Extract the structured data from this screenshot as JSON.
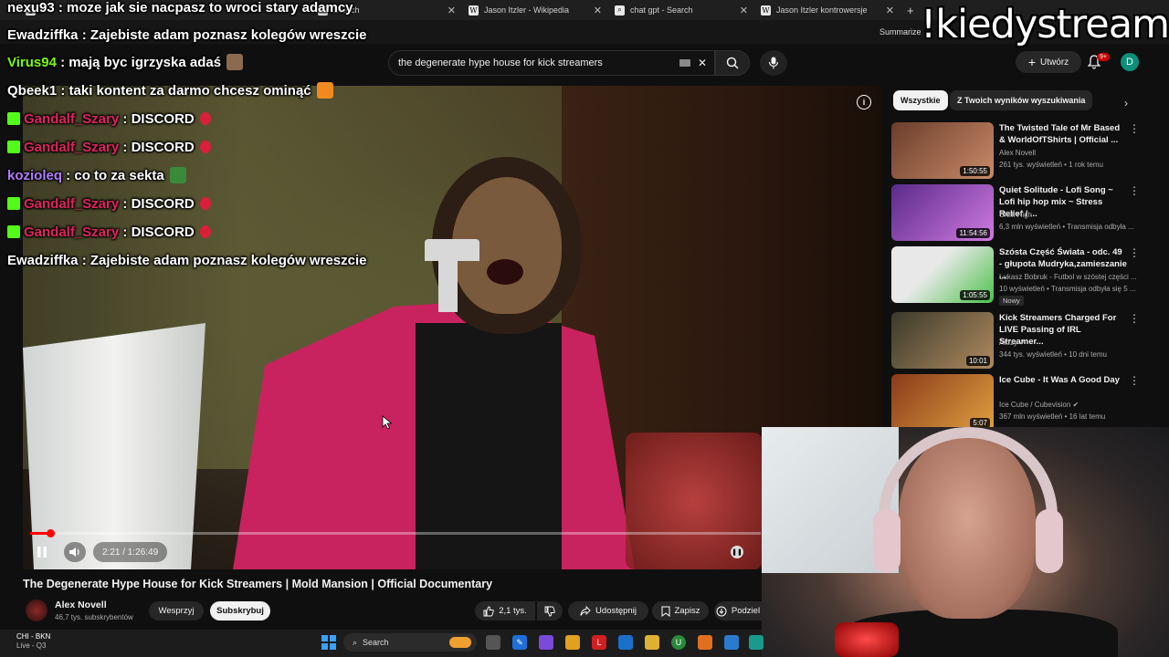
{
  "browser": {
    "tabs": [
      {
        "label": "",
        "icon": "app-icon"
      },
      {
        "label": "Search",
        "icon": "search-icon"
      },
      {
        "label": "Jason Itzler - Wikipedia",
        "icon": "wikipedia-icon"
      },
      {
        "label": "chat gpt - Search",
        "icon": "search-icon"
      },
      {
        "label": "Jason Itzler kontrowersje",
        "icon": "wikipedia-icon"
      }
    ],
    "summarize_label": "Summarize"
  },
  "overlay": {
    "command_text": "!kiedystream"
  },
  "chat": [
    {
      "user": "nexu93",
      "user_color": "#ffffff",
      "text": "moze jak sie nacpasz to wroci stary adamcy",
      "badge": false,
      "emote": ""
    },
    {
      "user": "Ewadziffka",
      "user_color": "#ffffff",
      "text": "Zajebiste adam poznasz kolegów wreszcie",
      "badge": false,
      "emote": ""
    },
    {
      "user": "Virus94",
      "user_color": "#7cfc00",
      "text": "mają byc igrzyska adaś",
      "badge": false,
      "emote": "face-emote"
    },
    {
      "user": "Qbeek1",
      "user_color": "#ffffff",
      "text": "taki kontent za darmo chcesz ominąć",
      "badge": false,
      "emote": "orange-emote"
    },
    {
      "user": "Gandalf_Szary",
      "user_color": "#e0245e",
      "text": "DISCORD",
      "badge": true,
      "emote": "red-drop-emote"
    },
    {
      "user": "Gandalf_Szary",
      "user_color": "#e0245e",
      "text": "DISCORD",
      "badge": true,
      "emote": "red-drop-emote"
    },
    {
      "user": "kozioleq",
      "user_color": "#b07cff",
      "text": "co to za sekta",
      "badge": false,
      "emote": "green-emote"
    },
    {
      "user": "Gandalf_Szary",
      "user_color": "#e0245e",
      "text": "DISCORD",
      "badge": true,
      "emote": "red-drop-emote"
    },
    {
      "user": "Gandalf_Szary",
      "user_color": "#e0245e",
      "text": "DISCORD",
      "badge": true,
      "emote": "red-drop-emote"
    },
    {
      "user": "Ewadziffka",
      "user_color": "#ffffff",
      "text": "Zajebiste adam poznasz kolegów wreszcie",
      "badge": false,
      "emote": ""
    }
  ],
  "youtube": {
    "search_value": "the degenerate hype house for kick streamers",
    "create_label": "Utwórz",
    "notification_count": "9+",
    "avatar_letter": "D"
  },
  "player": {
    "time": "2:21 / 1:26:49",
    "progress": 0.027
  },
  "video": {
    "title": "The Degenerate Hype House for Kick Streamers | Mold Mansion | Official Documentary",
    "channel": "Alex Novell",
    "subscribers": "46,7 tys. subskrybentów",
    "support_label": "Wesprzyj",
    "subscribe_label": "Subskrybuj",
    "likes": "2,1 tys.",
    "share_label": "Udostępnij",
    "save_label": "Zapisz",
    "download_label": "Podziel"
  },
  "chips": {
    "all": "Wszystkie",
    "related": "Z Twoich wyników wyszukiwania"
  },
  "recommendations": [
    {
      "title": "The Twisted Tale of Mr Based & WorldOfTShirts | Official ...",
      "channel": "Alex Novell",
      "meta": "261 tys. wyświetleń • 1 rok temu",
      "duration": "1:50:55",
      "badge": "",
      "thumb_colors": [
        "#6b3d2a",
        "#c98b6a"
      ]
    },
    {
      "title": "Quiet Solitude - Lofi Song ~ Lofi hip hop mix ~ Stress Relief / ...",
      "channel": "Chilli High",
      "meta": "6,3 mln wyświetleń • Transmisja odbyła ...",
      "duration": "11:54:56",
      "badge": "",
      "thumb_colors": [
        "#5a2a8a",
        "#d07ae0"
      ]
    },
    {
      "title": "Szósta Część Świata - odc. 49 - głupota Mudryka,zamieszanie ...",
      "channel": "Łukasz Bobruk - Futbol w szóstej części ...",
      "meta": "10 wyświetleń • Transmisja odbyła się 5 ...",
      "duration": "1:05:55",
      "badge": "Nowy",
      "thumb_colors": [
        "#e8e8e8",
        "#4cc24c"
      ]
    },
    {
      "title": "Kick Streamers Charged For LIVE Passing of IRL Streamer...",
      "channel": "Atozy",
      "meta": "344 tys. wyświetleń • 10 dni temu",
      "duration": "10:01",
      "badge": "",
      "thumb_colors": [
        "#3a3a2a",
        "#b08a60"
      ]
    },
    {
      "title": "Ice Cube - It Was A Good Day",
      "channel": "Ice Cube / Cubevision",
      "meta": "367 mln wyświetleń • 16 lat temu",
      "duration": "5:07",
      "badge": "",
      "thumb_colors": [
        "#8a3a1a",
        "#e0a040"
      ]
    }
  ],
  "taskbar": {
    "weather_line1": "CHI - BKN",
    "weather_line2": "Live - Q3",
    "search_label": "Search"
  }
}
